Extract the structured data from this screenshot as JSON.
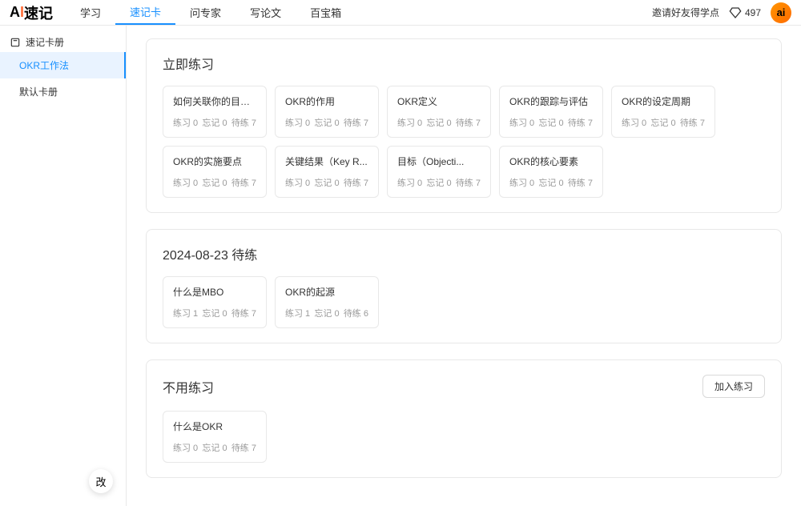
{
  "logo": {
    "a": "A",
    "i": "I",
    "text": "速记"
  },
  "nav": {
    "tabs": [
      {
        "label": "学习"
      },
      {
        "label": "速记卡"
      },
      {
        "label": "问专家"
      },
      {
        "label": "写论文"
      },
      {
        "label": "百宝箱"
      }
    ]
  },
  "header": {
    "invite": "邀请好友得学点",
    "points": "497",
    "avatar": "ai"
  },
  "sidebar": {
    "header": "速记卡册",
    "items": [
      {
        "label": "OKR工作法"
      },
      {
        "label": "默认卡册"
      }
    ],
    "floatBtn": "改"
  },
  "sections": [
    {
      "title": "立即练习",
      "cards": [
        {
          "title": "如何关联你的目标和行动",
          "p": "练习 0",
          "f": "忘记 0",
          "w": "待练 7"
        },
        {
          "title": "OKR的作用",
          "p": "练习 0",
          "f": "忘记 0",
          "w": "待练 7"
        },
        {
          "title": "OKR定义",
          "p": "练习 0",
          "f": "忘记 0",
          "w": "待练 7"
        },
        {
          "title": "OKR的跟踪与评估",
          "p": "练习 0",
          "f": "忘记 0",
          "w": "待练 7"
        },
        {
          "title": "OKR的设定周期",
          "p": "练习 0",
          "f": "忘记 0",
          "w": "待练 7"
        },
        {
          "title": "OKR的实施要点",
          "p": "练习 0",
          "f": "忘记 0",
          "w": "待练 7"
        },
        {
          "title": "关键结果（Key R...",
          "p": "练习 0",
          "f": "忘记 0",
          "w": "待练 7"
        },
        {
          "title": "目标（Objecti...",
          "p": "练习 0",
          "f": "忘记 0",
          "w": "待练 7"
        },
        {
          "title": "OKR的核心要素",
          "p": "练习 0",
          "f": "忘记 0",
          "w": "待练 7"
        }
      ]
    },
    {
      "title": "2024-08-23 待练",
      "cards": [
        {
          "title": "什么是MBO",
          "p": "练习 1",
          "f": "忘记 0",
          "w": "待练 7"
        },
        {
          "title": "OKR的起源",
          "p": "练习 1",
          "f": "忘记 0",
          "w": "待练 6"
        }
      ]
    },
    {
      "title": "不用练习",
      "button": "加入练习",
      "cards": [
        {
          "title": "什么是OKR",
          "p": "练习 0",
          "f": "忘记 0",
          "w": "待练 7"
        }
      ]
    }
  ]
}
